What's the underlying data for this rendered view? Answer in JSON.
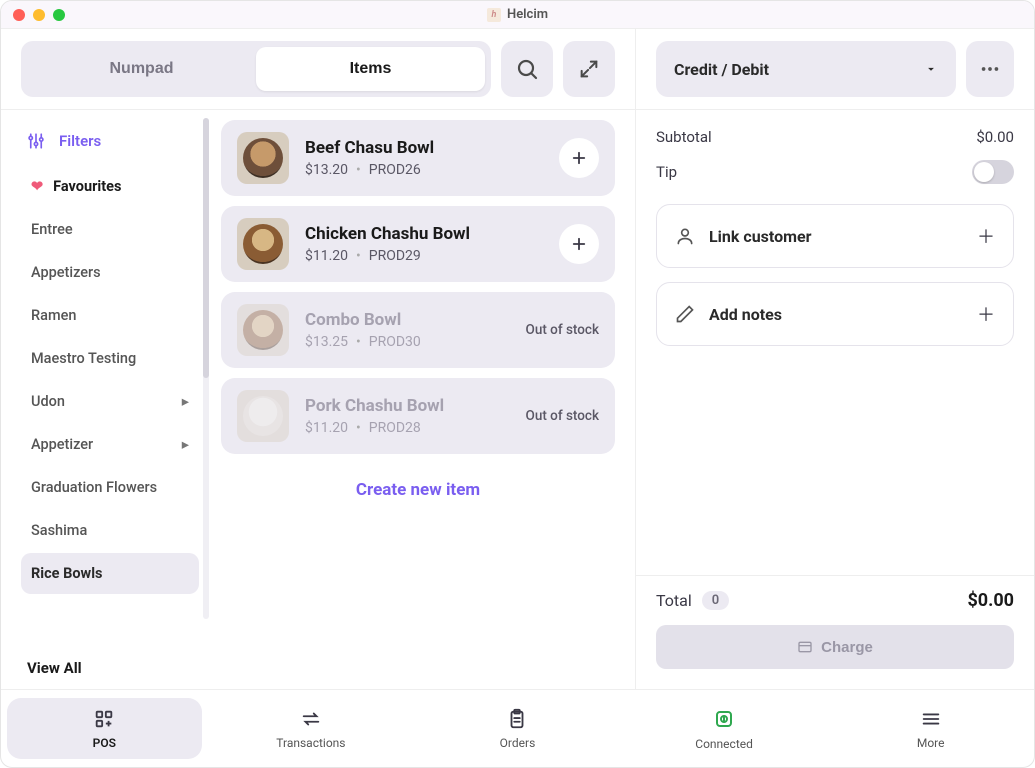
{
  "app_title": "Helcim",
  "toolbar": {
    "numpad_label": "Numpad",
    "items_label": "Items"
  },
  "sidebar": {
    "filters_label": "Filters",
    "view_all_label": "View All",
    "categories": [
      {
        "label": "Favourites",
        "fav": true
      },
      {
        "label": "Entree"
      },
      {
        "label": "Appetizers"
      },
      {
        "label": "Ramen"
      },
      {
        "label": "Maestro Testing"
      },
      {
        "label": "Udon",
        "expandable": true
      },
      {
        "label": "Appetizer",
        "expandable": true
      },
      {
        "label": "Graduation Flowers"
      },
      {
        "label": "Sashima"
      },
      {
        "label": "Rice Bowls",
        "active": true
      }
    ]
  },
  "products": [
    {
      "name": "Beef Chasu Bowl",
      "price": "$13.20",
      "sku": "PROD26",
      "in_stock": true,
      "thumb": "bowl"
    },
    {
      "name": "Chicken Chashu Bowl",
      "price": "$11.20",
      "sku": "PROD29",
      "in_stock": true,
      "thumb": "ch"
    },
    {
      "name": "Combo Bowl",
      "price": "$13.25",
      "sku": "PROD30",
      "in_stock": false,
      "thumb": "ch"
    },
    {
      "name": "Pork Chashu Bowl",
      "price": "$11.20",
      "sku": "PROD28",
      "in_stock": false,
      "thumb": "wh"
    }
  ],
  "out_of_stock_label": "Out of stock",
  "create_item_label": "Create new item",
  "cart": {
    "payment_method": "Credit / Debit",
    "subtotal_label": "Subtotal",
    "subtotal_value": "$0.00",
    "tip_label": "Tip",
    "link_customer_label": "Link customer",
    "add_notes_label": "Add notes",
    "total_label": "Total",
    "total_count": "0",
    "total_value": "$0.00",
    "charge_label": "Charge"
  },
  "nav": {
    "pos": "POS",
    "transactions": "Transactions",
    "orders": "Orders",
    "connected": "Connected",
    "more": "More"
  }
}
